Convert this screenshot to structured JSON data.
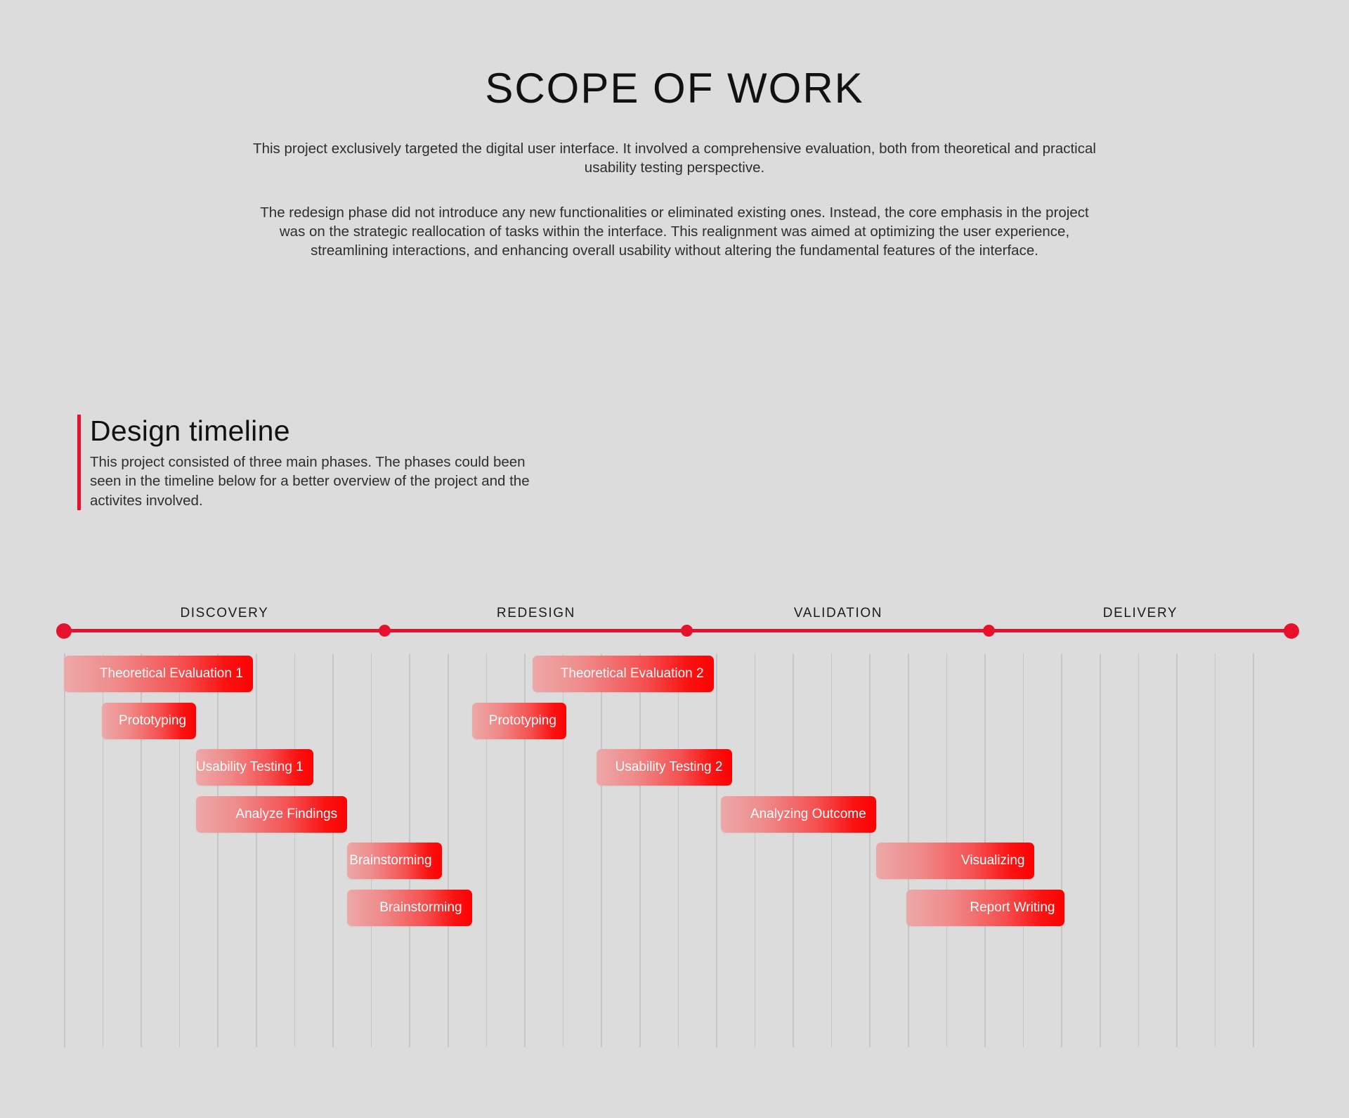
{
  "header": {
    "title": "SCOPE OF WORK",
    "paragraphs": [
      "This project exclusively targeted the digital user interface. It involved a comprehensive evaluation, both from theoretical and practical usability testing perspective.",
      "The redesign phase did not introduce any new functionalities or eliminated existing ones. Instead, the core emphasis in the project was on the strategic reallocation of tasks within the interface. This realignment was aimed at optimizing the user experience, streamlining interactions, and enhancing overall usability without altering the fundamental features of the interface."
    ]
  },
  "section": {
    "title": "Design timeline",
    "subtitle": "This project consisted of three main phases. The phases could been seen in the timeline below for a better overview of the project and the activites involved.",
    "accent_color": "#e8112d"
  },
  "chart_data": {
    "type": "bar",
    "chart_kind": "gantt",
    "title": "Design timeline",
    "xlabel": "",
    "ylabel": "",
    "grid": true,
    "legend": "none",
    "axis_color": "#e8112d",
    "bar_gradient": [
      "#eda8a8",
      "#ff0000"
    ],
    "grid_color": "#c6c6c6",
    "background": "#dcdcdc",
    "units": "columns",
    "xlim": [
      0,
      32.5
    ],
    "gridline_count": 32,
    "phases": [
      {
        "label": "DISCOVERY",
        "start": 0.0,
        "end": 8.5,
        "marker": "large"
      },
      {
        "label": "REDESIGN",
        "start": 8.5,
        "end": 16.5,
        "marker": "small"
      },
      {
        "label": "VALIDATION",
        "start": 16.5,
        "end": 24.5,
        "marker": "small"
      },
      {
        "label": "DELIVERY",
        "start": 24.5,
        "end": 32.5,
        "marker": "small"
      }
    ],
    "phase_markers": [
      {
        "pos": 0.0,
        "size": "large"
      },
      {
        "pos": 8.5,
        "size": "small"
      },
      {
        "pos": 16.5,
        "size": "small"
      },
      {
        "pos": 24.5,
        "size": "small"
      },
      {
        "pos": 32.5,
        "size": "large"
      }
    ],
    "categories": [
      "Theoretical Evaluation 1",
      "Prototyping",
      "Usability Testing 1",
      "Analyze Findings",
      "Brainstorming",
      "Brainstorming",
      "Theoretical Evaluation 2",
      "Prototyping",
      "Usability Testing 2",
      "Analyzing Outcome",
      "Visualizing",
      "Report Writing"
    ],
    "tasks": [
      {
        "label": "Theoretical Evaluation 1",
        "row": 0,
        "start": 0.0,
        "end": 5.0
      },
      {
        "label": "Prototyping",
        "row": 1,
        "start": 1.0,
        "end": 3.5
      },
      {
        "label": "Usability Testing 1",
        "row": 2,
        "start": 3.5,
        "end": 6.6
      },
      {
        "label": "Analyze Findings",
        "row": 3,
        "start": 3.5,
        "end": 7.5
      },
      {
        "label": "Brainstorming",
        "row": 4,
        "start": 7.5,
        "end": 10.0
      },
      {
        "label": "Brainstorming",
        "row": 5,
        "start": 7.5,
        "end": 10.8
      },
      {
        "label": "Theoretical Evaluation 2",
        "row": 0,
        "start": 12.4,
        "end": 17.2
      },
      {
        "label": "Prototyping",
        "row": 1,
        "start": 10.8,
        "end": 13.3
      },
      {
        "label": "Usability Testing 2",
        "row": 2,
        "start": 14.1,
        "end": 17.7
      },
      {
        "label": "Analyzing Outcome",
        "row": 3,
        "start": 17.4,
        "end": 21.5
      },
      {
        "label": "Visualizing",
        "row": 4,
        "start": 21.5,
        "end": 25.7
      },
      {
        "label": "Report Writing",
        "row": 5,
        "start": 22.3,
        "end": 26.5
      }
    ]
  }
}
